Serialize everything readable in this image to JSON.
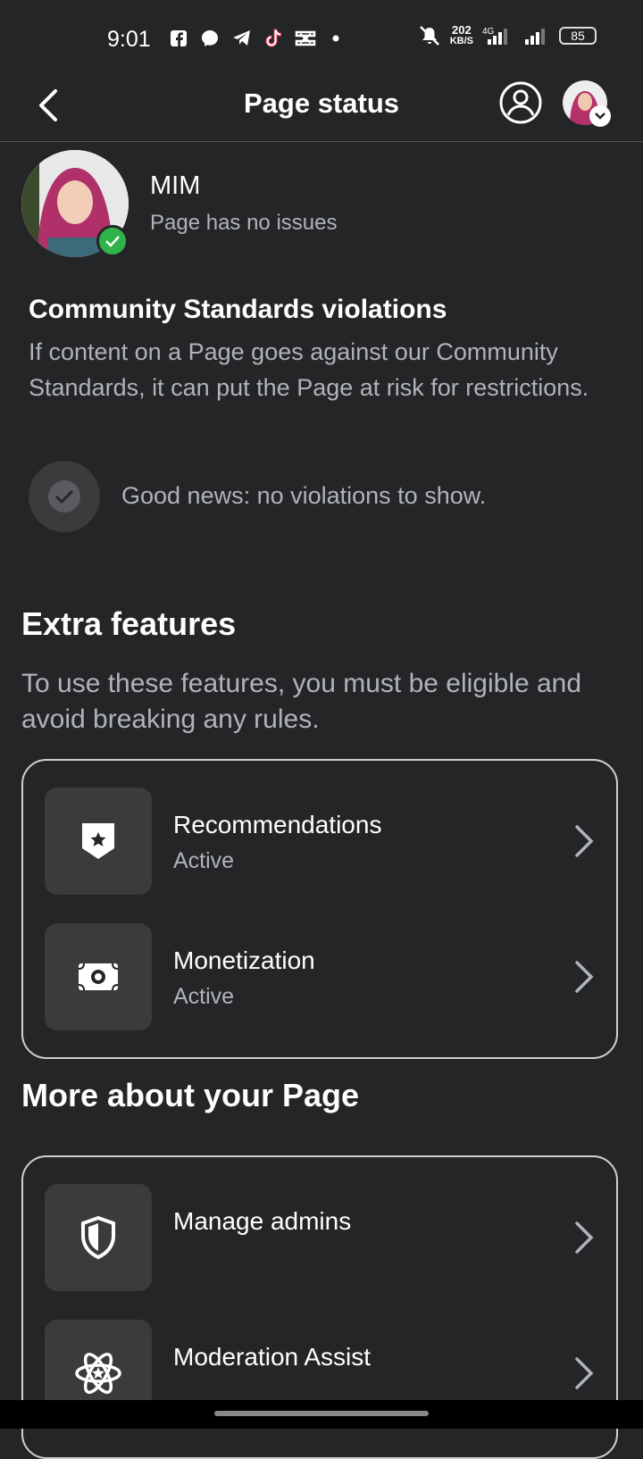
{
  "status_bar": {
    "time": "9:01",
    "speed_value": "202",
    "speed_unit": "KB/S",
    "network": "4G",
    "battery": "85"
  },
  "header": {
    "title": "Page status"
  },
  "page": {
    "name": "MIM",
    "status": "Page has no issues"
  },
  "community_standards": {
    "title": "Community Standards violations",
    "description": "If content on a Page goes against our Community Standards, it can put the Page at risk for restrictions.",
    "good_news": "Good news: no violations to show."
  },
  "extra_features": {
    "title": "Extra features",
    "description": "To use these features, you must be eligible and avoid breaking any rules.",
    "items": [
      {
        "label": "Recommendations",
        "status": "Active",
        "icon": "star-badge-icon"
      },
      {
        "label": "Monetization",
        "status": "Active",
        "icon": "money-icon"
      }
    ]
  },
  "more_about": {
    "title": "More about your Page",
    "items": [
      {
        "label": "Manage admins",
        "icon": "shield-icon"
      },
      {
        "label": "Moderation Assist",
        "icon": "atom-star-icon"
      }
    ]
  },
  "colors": {
    "background": "#242527",
    "surface": "#3a3b3d",
    "verified": "#2fb34a"
  }
}
